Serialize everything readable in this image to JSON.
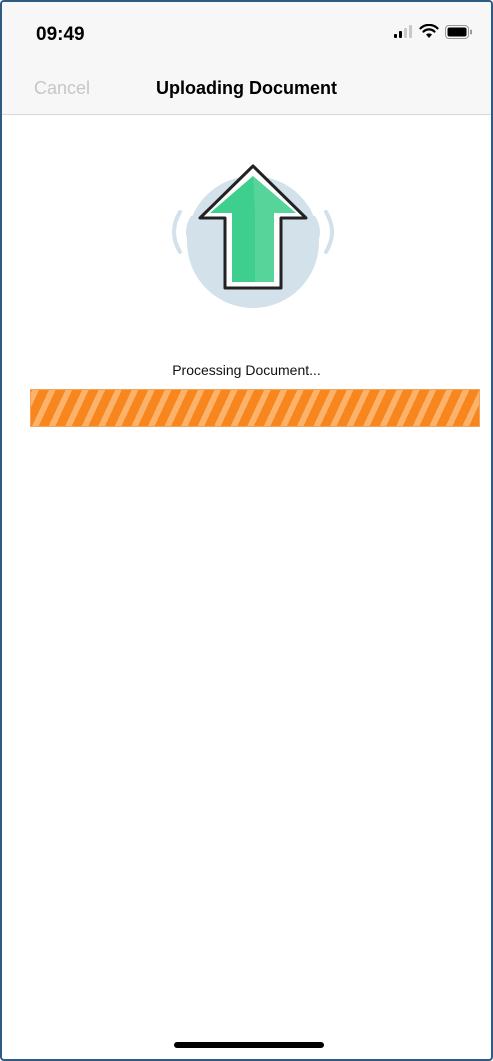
{
  "status_bar": {
    "time": "09:49",
    "icons": [
      "signal-icon",
      "wifi-icon",
      "battery-icon"
    ]
  },
  "nav": {
    "cancel_label": "Cancel",
    "title": "Uploading Document"
  },
  "upload": {
    "icon": "upload-arrow-icon",
    "status_text": "Processing Document...",
    "progress": 1.0
  },
  "colors": {
    "accent_green": "#3ecf8e",
    "progress_orange": "#f7861f",
    "circle_bg": "#d3e1ea",
    "cancel_disabled": "#c6c6c6"
  }
}
